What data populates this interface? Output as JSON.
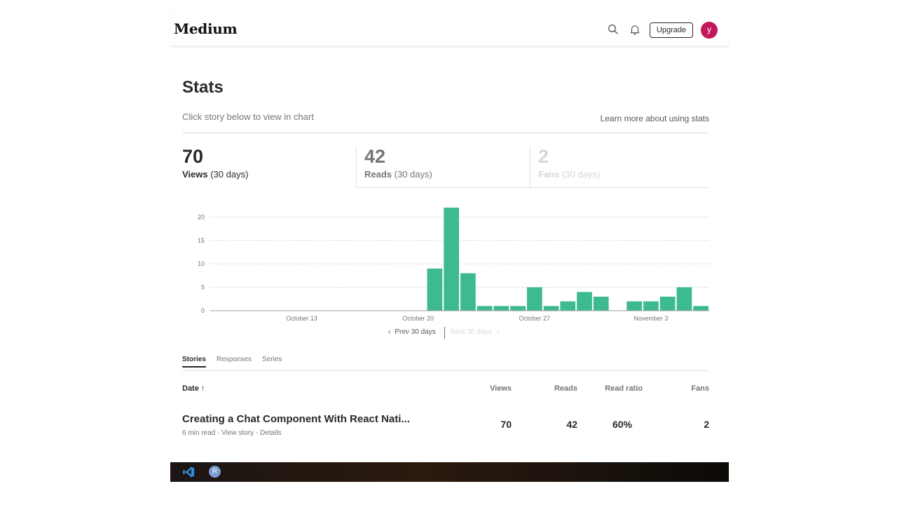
{
  "header": {
    "logo": "Medium",
    "upgrade_label": "Upgrade",
    "avatar_letter": "y",
    "icons": [
      "search-icon",
      "bell-icon"
    ]
  },
  "page": {
    "title": "Stats",
    "subtitle": "Click story below to view in chart",
    "learn_more": "Learn more about using stats"
  },
  "summary": [
    {
      "value": "70",
      "label": "Views",
      "period": "(30 days)",
      "active": true
    },
    {
      "value": "42",
      "label": "Reads",
      "period": "(30 days)",
      "active": false
    },
    {
      "value": "2",
      "label": "Fans",
      "period": "(30 days)",
      "disabled": true
    }
  ],
  "chart_data": {
    "type": "bar",
    "title": "",
    "xlabel": "",
    "ylabel": "",
    "ylim": [
      0,
      22
    ],
    "yticks": [
      0,
      5,
      10,
      15,
      20
    ],
    "xtick_labels": [
      "October 13",
      "October 20",
      "October 27",
      "November 3"
    ],
    "dates": [
      "Oct 8",
      "Oct 9",
      "Oct 10",
      "Oct 11",
      "Oct 12",
      "Oct 13",
      "Oct 14",
      "Oct 15",
      "Oct 16",
      "Oct 17",
      "Oct 18",
      "Oct 19",
      "Oct 20",
      "Oct 21",
      "Oct 22",
      "Oct 23",
      "Oct 24",
      "Oct 25",
      "Oct 26",
      "Oct 27",
      "Oct 28",
      "Oct 29",
      "Oct 30",
      "Oct 31",
      "Nov 1",
      "Nov 2",
      "Nov 3",
      "Nov 4",
      "Nov 5",
      "Nov 6"
    ],
    "values": [
      0,
      0,
      0,
      0,
      0,
      0,
      0,
      0,
      0,
      0,
      0,
      0,
      0,
      9,
      22,
      8,
      1,
      1,
      1,
      5,
      1,
      2,
      4,
      3,
      0,
      2,
      2,
      3,
      5,
      1
    ],
    "bar_color": "#3dba91",
    "grid": true
  },
  "pager": {
    "prev": "Prev 30 days",
    "next": "Next 30 days"
  },
  "tabs": [
    "Stories",
    "Responses",
    "Series"
  ],
  "table": {
    "columns": [
      "Date",
      "Views",
      "Reads",
      "Read ratio",
      "Fans"
    ],
    "rows": [
      {
        "title": "Creating a Chat Component With React Nati...",
        "read_time": "6 min read",
        "view_story": "View story",
        "details": "Details",
        "views": "70",
        "reads": "42",
        "ratio": "60%",
        "fans": "2"
      }
    ]
  },
  "taskbar": {
    "icons": [
      "vscode-icon",
      "r-app-icon"
    ],
    "r_letter": "R"
  }
}
